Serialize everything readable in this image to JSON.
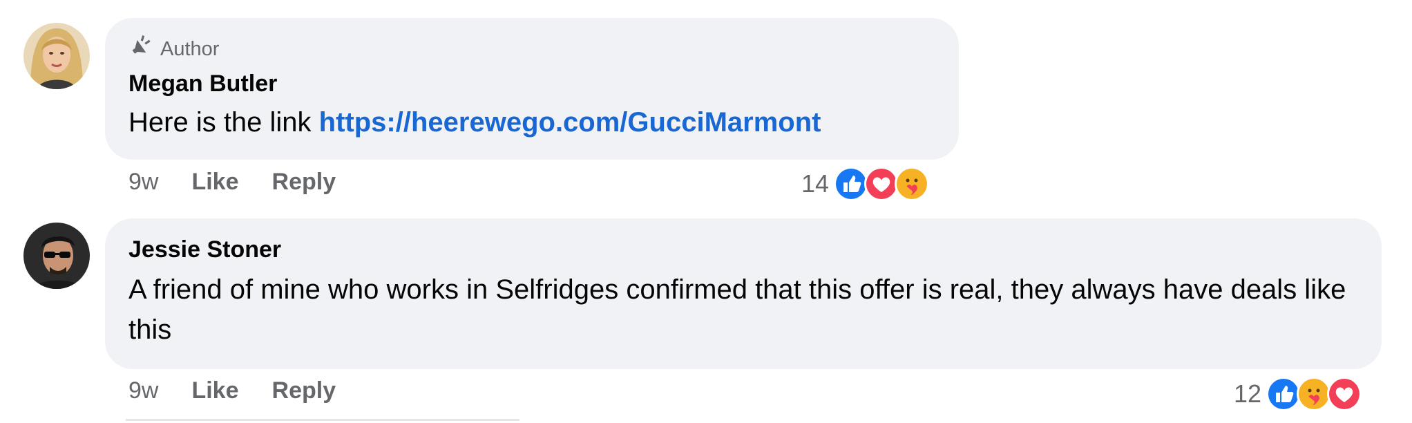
{
  "comments": [
    {
      "author_badge": "Author",
      "name": "Megan Butler",
      "text_prefix": "Here is the link ",
      "link": "https://heerewego.com/GucciMarmont",
      "time": "9w",
      "like_label": "Like",
      "reply_label": "Reply",
      "reaction_count": "14",
      "reactions": [
        "like-reaction-icon",
        "love-reaction-icon",
        "care-reaction-icon"
      ]
    },
    {
      "name": "Jessie Stoner",
      "text": "A friend of mine who works in Selfridges confirmed that this offer is real, they always have deals like this",
      "time": "9w",
      "like_label": "Like",
      "reply_label": "Reply",
      "reaction_count": "12",
      "reactions": [
        "like-reaction-icon",
        "care-reaction-icon",
        "love-reaction-icon"
      ]
    }
  ],
  "colors": {
    "bubble": "#f0f2f5",
    "link": "#1967d2",
    "like": "#1877f2",
    "love": "#f33e58",
    "care": "#f7b125"
  }
}
